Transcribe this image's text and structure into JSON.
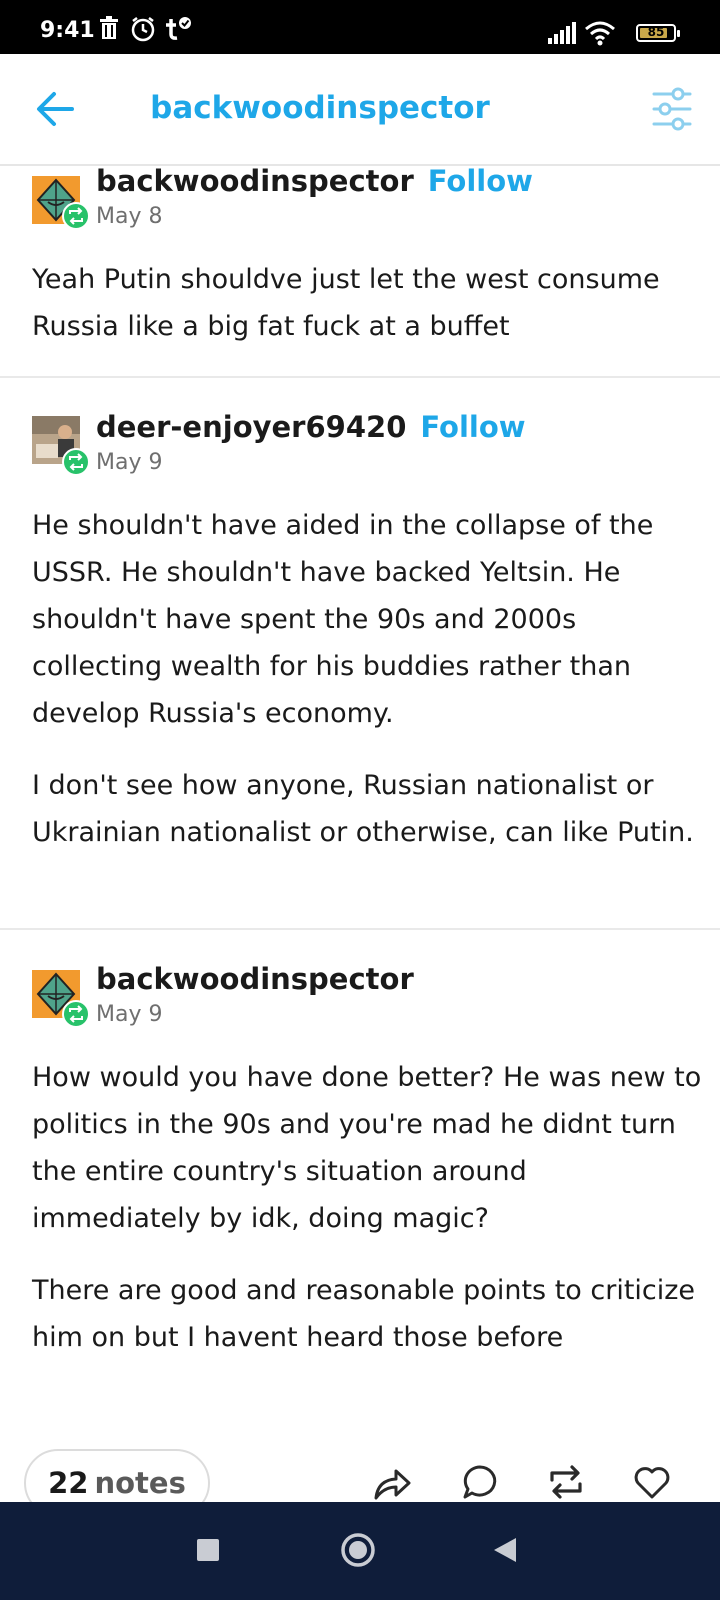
{
  "status_bar": {
    "time": "9:41",
    "battery": "85",
    "battery_fraction": 0.85,
    "icons": [
      "trash-icon",
      "alarm-icon",
      "tumblr-check-icon",
      "signal-icon",
      "wifi-icon",
      "battery-icon"
    ]
  },
  "header": {
    "title": "backwoodinspector",
    "back_icon": "back-arrow-icon",
    "filter_icon": "sliders-icon",
    "accent_color": "#1ea7e8"
  },
  "posts": [
    {
      "username": "backwoodinspector",
      "follow_label": "Follow",
      "date": "May 8",
      "paragraphs": [
        "Yeah Putin shouldve just let the west consume Russia like a big fat fuck at a buffet"
      ]
    },
    {
      "username": "deer-enjoyer69420",
      "follow_label": "Follow",
      "date": "May 9",
      "paragraphs": [
        "He shouldn't have aided in the collapse of the USSR. He shouldn't have backed Yeltsin. He shouldn't have spent the 90s and 2000s collecting wealth for his buddies rather than develop Russia's economy.",
        "I don't see how anyone, Russian nationalist or Ukrainian nationalist or otherwise, can like Putin."
      ]
    },
    {
      "username": "backwoodinspector",
      "date": "May 9",
      "paragraphs": [
        "How would you have done better? He was new to politics in the 90s and you're mad he didnt turn the entire country's situation around immediately by idk, doing magic?",
        "There are good and reasonable points to criticize him on but I havent heard those before"
      ]
    }
  ],
  "footer": {
    "notes_count": "22",
    "notes_label": "notes",
    "actions": [
      "share-icon",
      "reply-icon",
      "reblog-icon",
      "like-icon"
    ]
  },
  "nav_bar": {
    "buttons": [
      "recents-square-icon",
      "home-circle-icon",
      "back-triangle-icon"
    ],
    "background": "#0f1d3a"
  },
  "colors": {
    "reblog_badge": "#28c26a",
    "divider": "#e9e9e9"
  }
}
